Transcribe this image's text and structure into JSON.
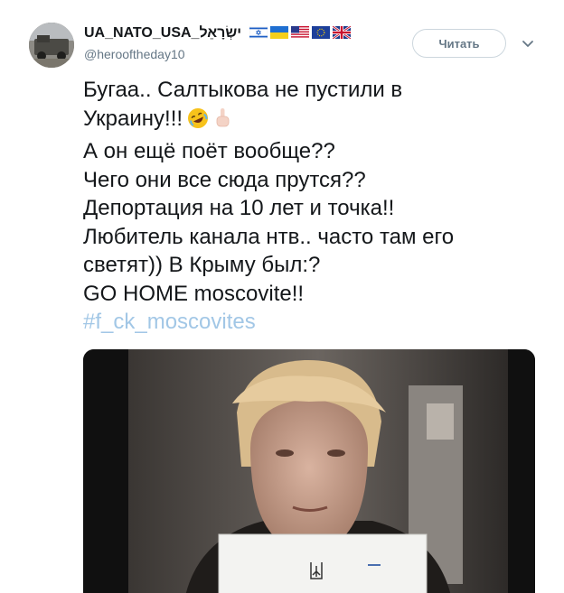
{
  "tweet": {
    "display_name": "UA_NATO_USA_ישְׂרָאֵל",
    "username": "@herooftheday10",
    "follow_label": "Читать",
    "flags": [
      "israel-flag-icon",
      "ukraine-flag-icon",
      "usa-flag-icon",
      "eu-flag-icon",
      "uk-flag-icon"
    ],
    "lines": [
      "Бугаа.. Салтыкова не пустили в",
      "Украину!!!",
      "А он ещё поёт вообще??",
      "Чего они все сюда прутся??",
      "Депортация на 10 лет и точка!!",
      "Любитель канала нтв.. часто там его",
      "светят)) В Крыму был:?",
      "GO HOME moscovite!!"
    ],
    "hashtag": "#f_ck_moscovites",
    "emojis": [
      "rolling-laughing-icon",
      "middle-finger-icon"
    ]
  },
  "colors": {
    "name": "#14171a",
    "secondary": "#657786",
    "hashtag": "#a2c7e6",
    "button_border": "#ccd6dd"
  }
}
